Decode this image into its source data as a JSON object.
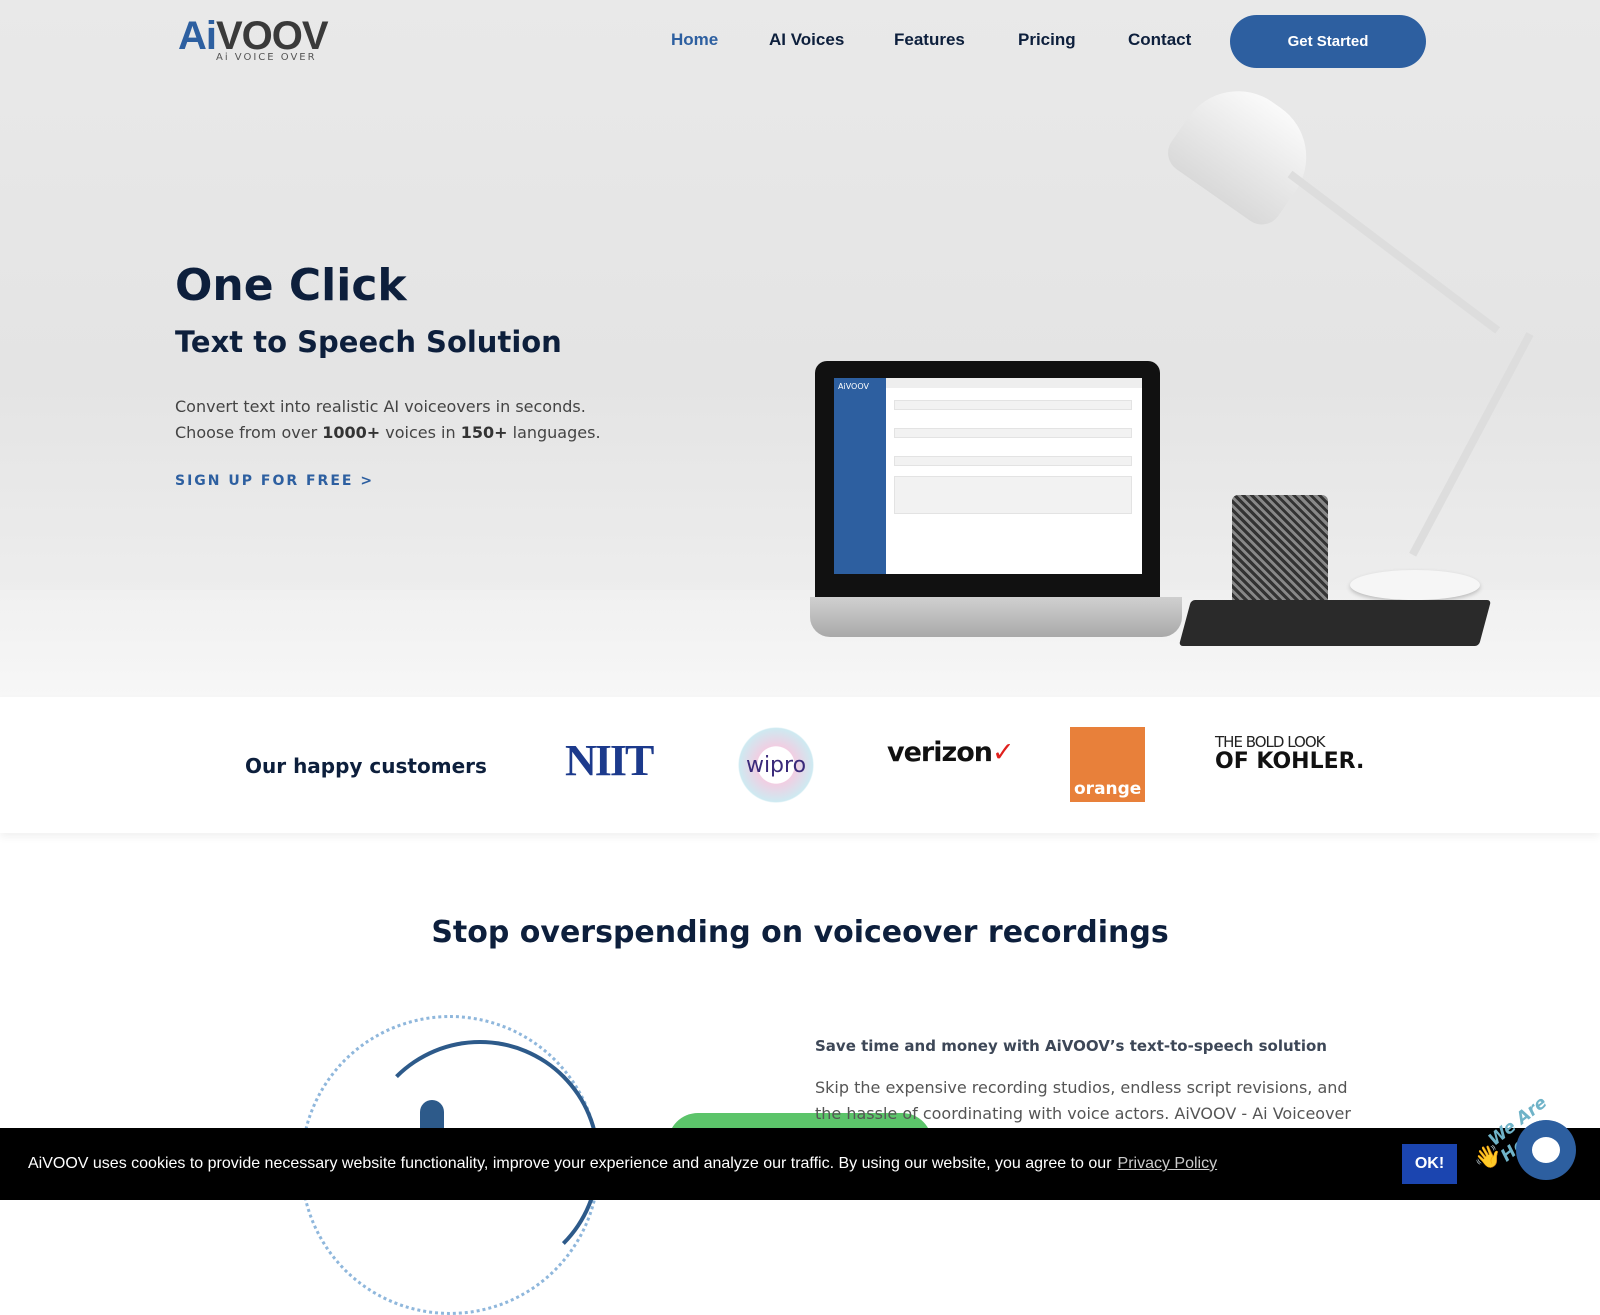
{
  "header": {
    "logo_main_prefix": "Ai",
    "logo_main_suffix": "VOOV",
    "logo_sub": "Ai VOICE OVER",
    "nav": [
      "Home",
      "AI Voices",
      "Features",
      "Pricing",
      "Contact"
    ],
    "active_nav": "Home",
    "cta_label": "Get Started"
  },
  "hero": {
    "title": "One Click",
    "subtitle": "Text to Speech Solution",
    "line1": "Convert text into realistic AI voiceovers in seconds.",
    "line2_a": "Choose from over ",
    "line2_b": "1000+",
    "line2_c": " voices in ",
    "line2_d": "150+",
    "line2_e": " languages.",
    "signup": "SIGN UP FOR FREE >",
    "screen_brand": "AiVOOV"
  },
  "customers": {
    "title": "Our happy customers",
    "logos": {
      "niit": "NIIT",
      "wipro": "wipro",
      "verizon": "verizon",
      "verizon_check": "✓",
      "orange": "orange",
      "kohler_top": "THE BOLD LOOK",
      "kohler_bottom": "OF KOHLER."
    }
  },
  "section": {
    "title": "Stop overspending on voiceover recordings",
    "heading": "Save time and money with AiVOOV’s text-to-speech solution",
    "body": "Skip the expensive recording studios, endless script revisions, and the hassle of coordinating with voice actors. AiVOOV - Ai Voiceover"
  },
  "cookie": {
    "text": "AiVOOV uses cookies to provide necessary website functionality, improve your experience and analyze our traffic. By using our website, you agree to our",
    "link": "Privacy Policy",
    "ok": "OK!"
  },
  "chat": {
    "badge": "We Are Here!",
    "icon": "chat-bubble-icon"
  },
  "colors": {
    "brand": "#2d5fa0",
    "heading": "#0d1f3c",
    "ok_button": "#1b45b0"
  }
}
